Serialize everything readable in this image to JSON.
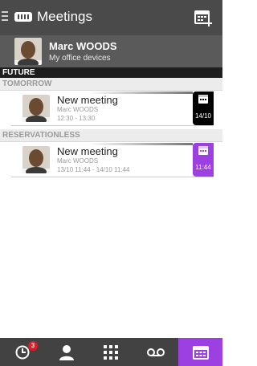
{
  "app": {
    "title": "Meetings"
  },
  "profile": {
    "name": "Marc WOODS",
    "subtitle": "My office devices"
  },
  "sections": {
    "future": "FUTURE",
    "tomorrow": "TOMORROW",
    "reservationless": "RESERVATIONLESS"
  },
  "meetings": [
    {
      "title": "New meeting",
      "organizer": "Marc WOODS",
      "time": "12:30 - 13:30",
      "badge_text": "14/10",
      "badge_color": "#000000"
    },
    {
      "title": "New meeting",
      "organizer": "Marc WOODS",
      "time": "13/10 11:44 - 14/10 11:44",
      "badge_text": "11:44",
      "badge_color": "#9c40e2"
    }
  ],
  "bottom_nav": {
    "items": [
      "history-icon",
      "contacts-icon",
      "dialpad-icon",
      "voicemail-icon",
      "meetings-icon"
    ],
    "active": "meetings-icon",
    "history_badge": "3"
  },
  "colors": {
    "accent": "#9c40e2",
    "header_bg": "#4a4a4a",
    "bottom_bar_bg": "#424242",
    "notification": "#e01b24"
  }
}
